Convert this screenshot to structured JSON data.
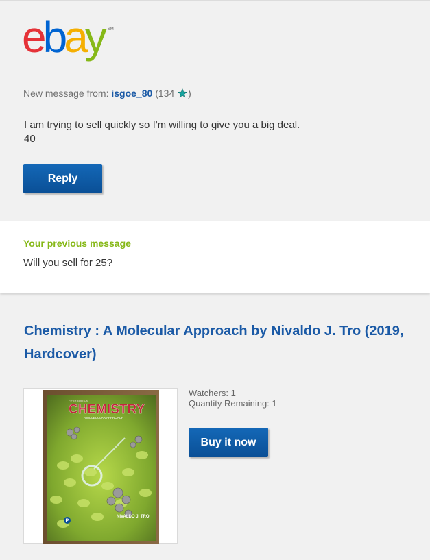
{
  "brand": {
    "letters": [
      "e",
      "b",
      "a",
      "y"
    ],
    "letter_colors": [
      "#e53238",
      "#0064d2",
      "#f5af02",
      "#86b817"
    ],
    "trademark": "SM"
  },
  "message": {
    "from_label": "New message from:",
    "sender": "isgoe_80",
    "score_open": "(134",
    "score_close": ")",
    "star_icon": "teal-star-icon",
    "body_line1": "I am trying to sell quickly so I'm willing to give you a big deal.",
    "body_line2": "40",
    "reply_label": "Reply"
  },
  "previous": {
    "label": "Your previous message",
    "text": "Will you sell for 25?"
  },
  "item": {
    "title": "Chemistry : A Molecular Approach by Nivaldo J. Tro (2019, Hardcover)",
    "watchers": "Watchers: 1",
    "quantity": "Quantity Remaining: 1",
    "buy_label": "Buy it now",
    "image": {
      "cover_title": "CHEMISTRY",
      "cover_subtitle": "A MOLECULAR APPROACH",
      "cover_edition": "FIFTH EDITION",
      "cover_author": "NIVALDO J. TRO"
    }
  },
  "colors": {
    "link_blue": "#1b5aa6",
    "button_blue": "#0b5cac",
    "previous_label_green": "#86b817",
    "background": "#f1f1f1"
  }
}
